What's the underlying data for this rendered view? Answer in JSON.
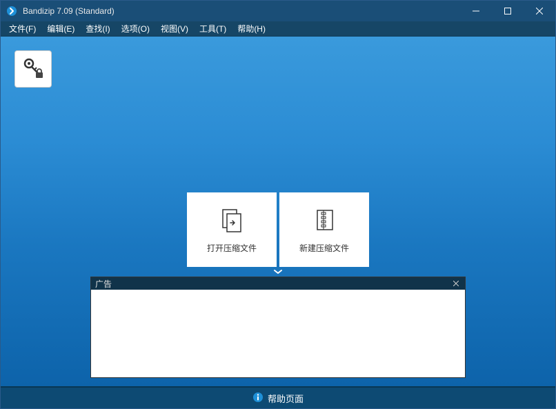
{
  "window": {
    "title": "Bandizip 7.09 (Standard)"
  },
  "menu": {
    "file": "文件(F)",
    "edit": "编辑(E)",
    "find": "查找(I)",
    "options": "选项(O)",
    "view": "视图(V)",
    "tools": "工具(T)",
    "help": "帮助(H)"
  },
  "actions": {
    "open_archive": "打开压缩文件",
    "new_archive": "新建压缩文件"
  },
  "ad": {
    "title": "广告"
  },
  "footer": {
    "help_page": "帮助页面"
  }
}
